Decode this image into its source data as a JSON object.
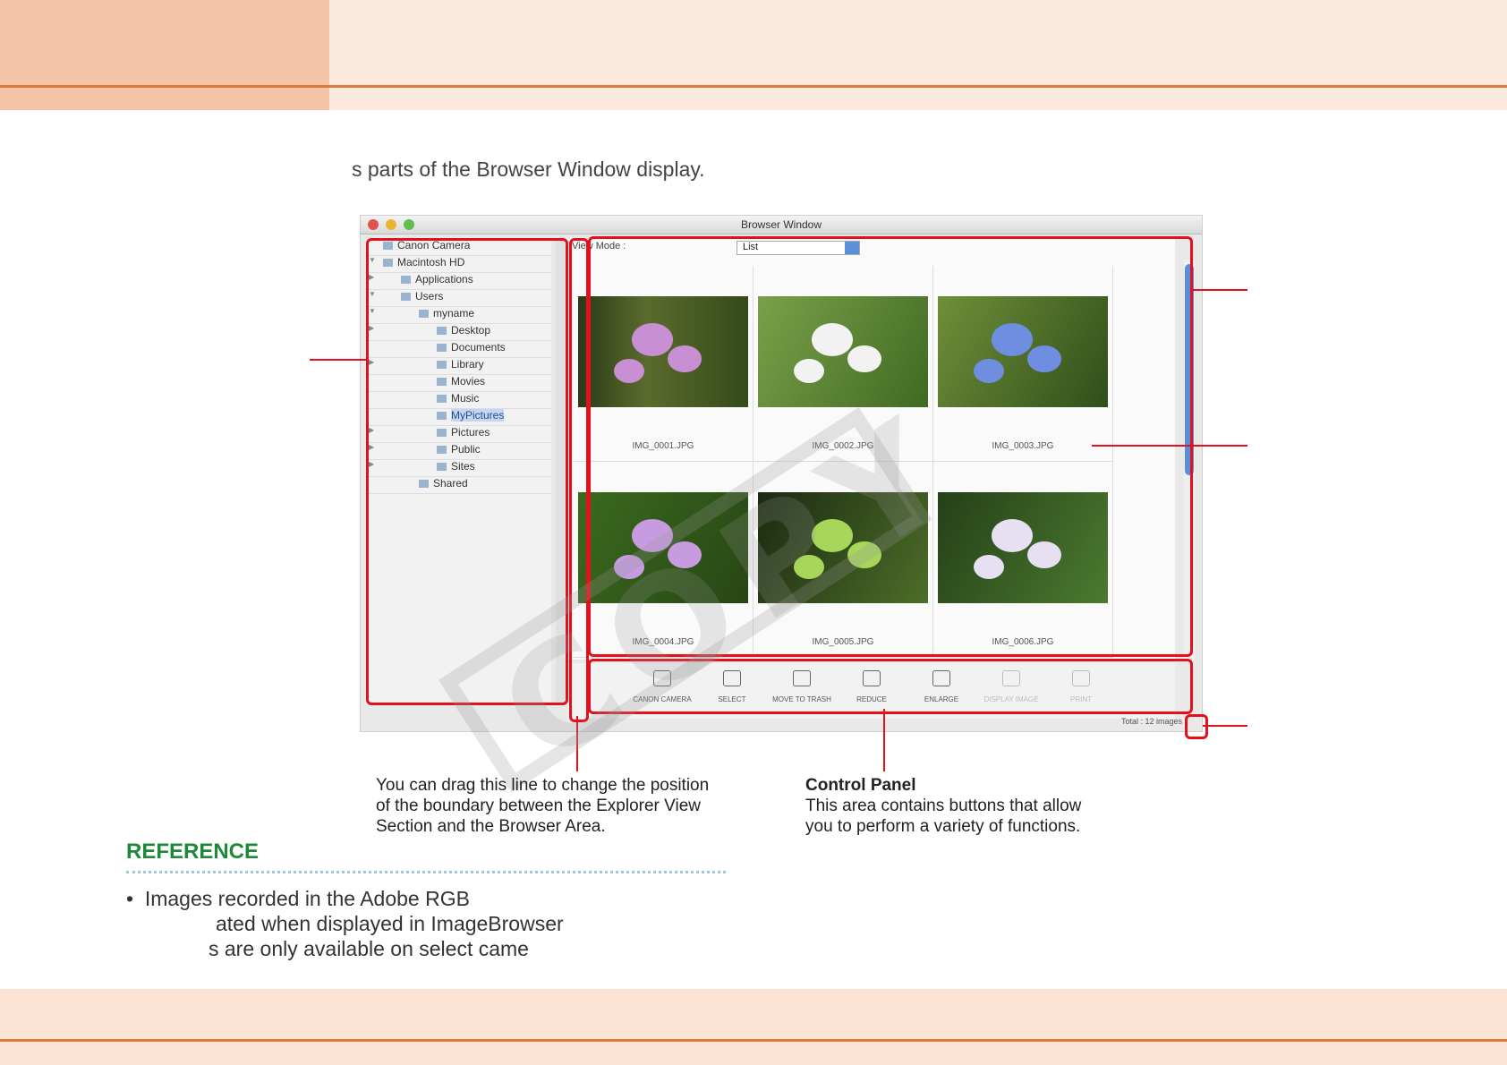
{
  "intro_text": "s parts of the Browser Window display.",
  "window": {
    "title": "Browser Window",
    "tree": [
      {
        "label": "Canon Camera",
        "indent": 0,
        "arrow": ""
      },
      {
        "label": "Macintosh HD",
        "indent": 0,
        "arrow": "▼"
      },
      {
        "label": "Applications",
        "indent": 1,
        "arrow": "▶"
      },
      {
        "label": "Users",
        "indent": 1,
        "arrow": "▼"
      },
      {
        "label": "myname",
        "indent": 2,
        "arrow": "▼"
      },
      {
        "label": "Desktop",
        "indent": 3,
        "arrow": "▶"
      },
      {
        "label": "Documents",
        "indent": 3,
        "arrow": ""
      },
      {
        "label": "Library",
        "indent": 3,
        "arrow": "▶"
      },
      {
        "label": "Movies",
        "indent": 3,
        "arrow": ""
      },
      {
        "label": "Music",
        "indent": 3,
        "arrow": ""
      },
      {
        "label": "MyPictures",
        "indent": 3,
        "arrow": "",
        "selected": true
      },
      {
        "label": "Pictures",
        "indent": 3,
        "arrow": "▶"
      },
      {
        "label": "Public",
        "indent": 3,
        "arrow": "▶"
      },
      {
        "label": "Sites",
        "indent": 3,
        "arrow": "▶"
      },
      {
        "label": "Shared",
        "indent": 2,
        "arrow": ""
      }
    ],
    "view_mode_label": "View Mode :",
    "view_mode_value": "List",
    "images": [
      "IMG_0001.JPG",
      "IMG_0002.JPG",
      "IMG_0003.JPG",
      "IMG_0004.JPG",
      "IMG_0005.JPG",
      "IMG_0006.JPG"
    ],
    "controls": [
      {
        "label": "CANON CAMERA",
        "enabled": true
      },
      {
        "label": "SELECT",
        "enabled": true
      },
      {
        "label": "MOVE TO TRASH",
        "enabled": true
      },
      {
        "label": "REDUCE",
        "enabled": true
      },
      {
        "label": "ENLARGE",
        "enabled": true
      },
      {
        "label": "DISPLAY IMAGE",
        "enabled": false
      },
      {
        "label": "PRINT",
        "enabled": false
      }
    ],
    "total_text": "Total : 12 images"
  },
  "callout_splitter": "You can drag this line to change the position of the boundary between the Explorer View Section and the Browser Area.",
  "callout_control": {
    "title": "Control Panel",
    "body": "This area contains buttons that allow you to perform a variety of functions."
  },
  "reference": {
    "title": "REFERENCE",
    "bullet": "•",
    "lines": [
      "Images recorded in the Adobe RGB",
      "ated when displayed in ImageBrowser",
      "s are only available on select came"
    ]
  },
  "watermark": "COPY",
  "colors": {
    "accent": "#e07a3c",
    "header_dark": "#f3c4a6",
    "header_light": "#fbe9dd",
    "annotation": "#e3101d",
    "reference": "#1d8a3a"
  }
}
